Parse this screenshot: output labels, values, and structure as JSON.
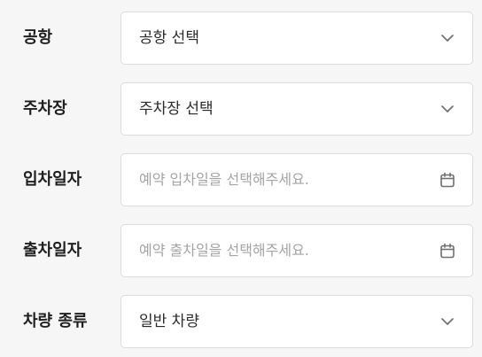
{
  "form": {
    "airport": {
      "label": "공항",
      "value": "공항 선택",
      "icon": "chevron-down-icon"
    },
    "parking": {
      "label": "주차장",
      "value": "주차장 선택",
      "icon": "chevron-down-icon"
    },
    "checkin": {
      "label": "입차일자",
      "placeholder": "예약 입차일을 선택해주세요.",
      "icon": "calendar-icon"
    },
    "checkout": {
      "label": "출차일자",
      "placeholder": "예약 출차일을 선택해주세요.",
      "icon": "calendar-icon"
    },
    "vehicle": {
      "label": "차량 종류",
      "value": "일반 차량",
      "icon": "chevron-down-icon"
    }
  },
  "colors": {
    "background": "#f6f6f6",
    "field_border": "#dcdcdc",
    "label_text": "#1f1f1f",
    "value_text": "#2a2a2a",
    "placeholder_text": "#a4a4a4",
    "icon_stroke": "#6f6f6f"
  }
}
